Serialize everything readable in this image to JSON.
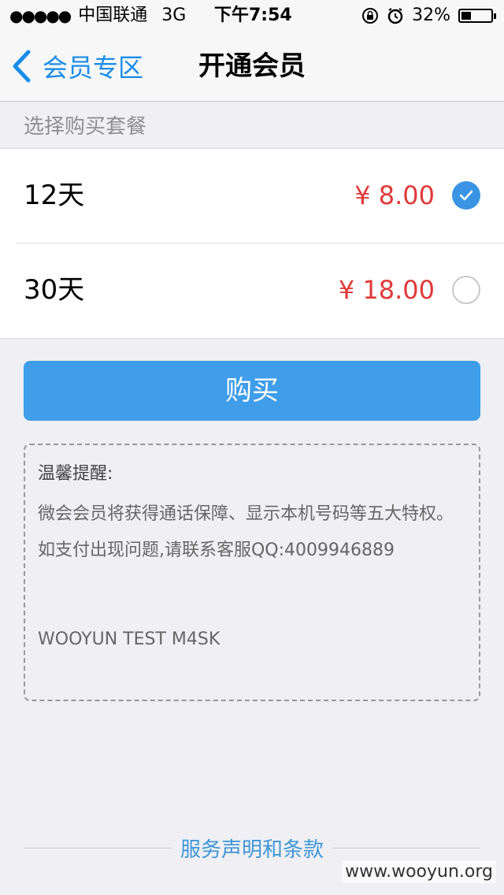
{
  "status_bar": {
    "signal": "●●●●●",
    "carrier": "中国联通",
    "network": "3G",
    "time": "下午7:54",
    "battery_percent": "32%",
    "battery_level": 0.32
  },
  "nav": {
    "back_label": "会员专区",
    "title": "开通会员"
  },
  "section_header": "选择购买套餐",
  "plans": [
    {
      "name": "12天",
      "price": "¥ 8.00",
      "selected": true
    },
    {
      "name": "30天",
      "price": "¥ 18.00",
      "selected": false
    }
  ],
  "buy_label": "购买",
  "notice": {
    "title": "温馨提醒:",
    "p1": "微会会员将获得通话保障、显示本机号码等五大特权。",
    "p2": "如支付出现问题,请联系客服QQ:4009946889",
    "p3": "WOOYUN TEST M4SK"
  },
  "footer_link": "服务声明和条款",
  "watermark": "www.wooyun.org",
  "colors": {
    "accent": "#3f9de9",
    "price": "#e03a3a",
    "nav_blue": "#1a8de8"
  }
}
